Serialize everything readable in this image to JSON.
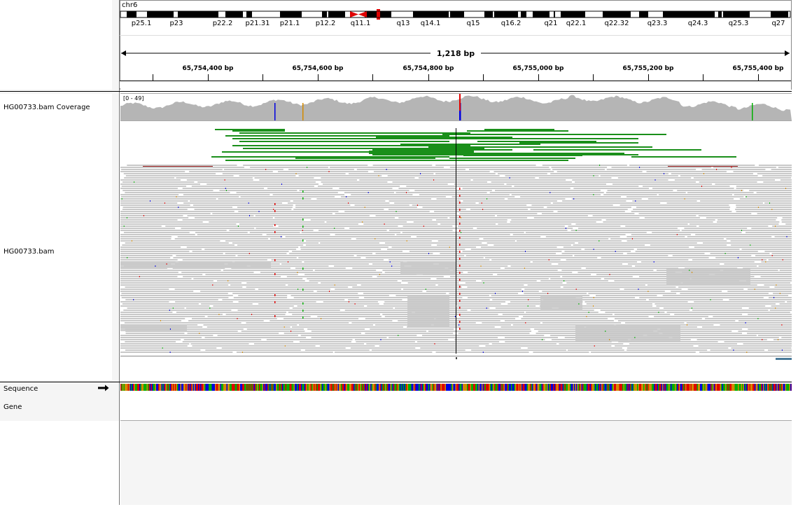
{
  "header": {
    "chromosome": "chr6",
    "span_label": "1,218 bp",
    "ideogram_bands": [
      "p25.1",
      "p23",
      "p22.2",
      "p21.31",
      "p21.1",
      "p12.2",
      "q11.1",
      "q13",
      "q14.1",
      "q15",
      "q16.2",
      "q21",
      "q22.1",
      "q22.32",
      "q23.3",
      "q24.3",
      "q25.3",
      "q27"
    ],
    "ruler_ticks": [
      "65,754,400 bp",
      "65,754,600 bp",
      "65,754,800 bp",
      "65,755,000 bp",
      "65,755,200 bp",
      "65,755,400 bp"
    ]
  },
  "tracks": {
    "coverage": {
      "name": "HG00733.bam Coverage",
      "range": "[0 - 49]"
    },
    "alignments": {
      "name": "HG00733.bam"
    },
    "sequence": {
      "name": "Sequence"
    },
    "gene": {
      "name": "Gene"
    }
  },
  "colors": {
    "coverage_fill": "#b5b5b5",
    "read_gray": "#c8c8c8",
    "read_green": "#1a8f1a",
    "read_red": "#9b1c1c",
    "centromere_red": "#e00000",
    "mismatch_A": "#00b000",
    "mismatch_C": "#0000e0",
    "mismatch_G": "#d48a00",
    "mismatch_T": "#e00000"
  }
}
